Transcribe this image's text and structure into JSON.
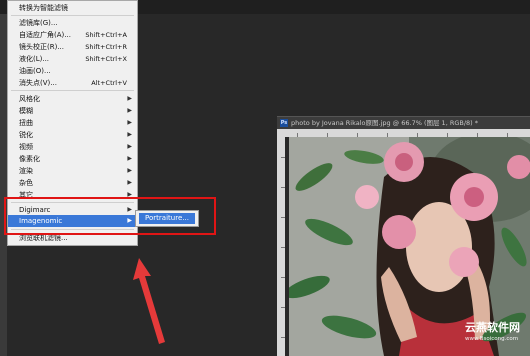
{
  "menu": {
    "items": [
      {
        "label": "转换为智能滤镜",
        "shortcut": "",
        "submenu": false
      },
      {
        "label": "滤镜库(G)...",
        "shortcut": "",
        "submenu": false
      },
      {
        "label": "自适应广角(A)...",
        "shortcut": "Shift+Ctrl+A",
        "submenu": false
      },
      {
        "label": "镜头校正(R)...",
        "shortcut": "Shift+Ctrl+R",
        "submenu": false
      },
      {
        "label": "液化(L)...",
        "shortcut": "Shift+Ctrl+X",
        "submenu": false
      },
      {
        "label": "油画(O)...",
        "shortcut": "",
        "submenu": false
      },
      {
        "label": "消失点(V)...",
        "shortcut": "Alt+Ctrl+V",
        "submenu": false
      },
      {
        "label": "风格化",
        "shortcut": "",
        "submenu": true
      },
      {
        "label": "模糊",
        "shortcut": "",
        "submenu": true
      },
      {
        "label": "扭曲",
        "shortcut": "",
        "submenu": true
      },
      {
        "label": "锐化",
        "shortcut": "",
        "submenu": true
      },
      {
        "label": "视频",
        "shortcut": "",
        "submenu": true
      },
      {
        "label": "像素化",
        "shortcut": "",
        "submenu": true
      },
      {
        "label": "渲染",
        "shortcut": "",
        "submenu": true
      },
      {
        "label": "杂色",
        "shortcut": "",
        "submenu": true
      },
      {
        "label": "其它",
        "shortcut": "",
        "submenu": true
      },
      {
        "label": "Digimarc",
        "shortcut": "",
        "submenu": true
      },
      {
        "label": "Imagenomic",
        "shortcut": "",
        "submenu": true
      },
      {
        "label": "浏览联机滤镜...",
        "shortcut": "",
        "submenu": false
      }
    ],
    "highlighted": "Imagenomic"
  },
  "submenu": {
    "items": [
      {
        "label": "Portraiture..."
      }
    ]
  },
  "document": {
    "title": "photo by Jovana Rikalo原图.jpg @ 66.7% (图层 1, RGB/8) *",
    "app_icon": "Ps"
  },
  "watermark": {
    "line1": "云燕软件网",
    "line2": "www.Bsoicong.com"
  },
  "colors": {
    "highlight": "#3a78d8",
    "annotation": "#e01515",
    "menu_bg": "#f0f0f0",
    "workspace": "#282828"
  }
}
